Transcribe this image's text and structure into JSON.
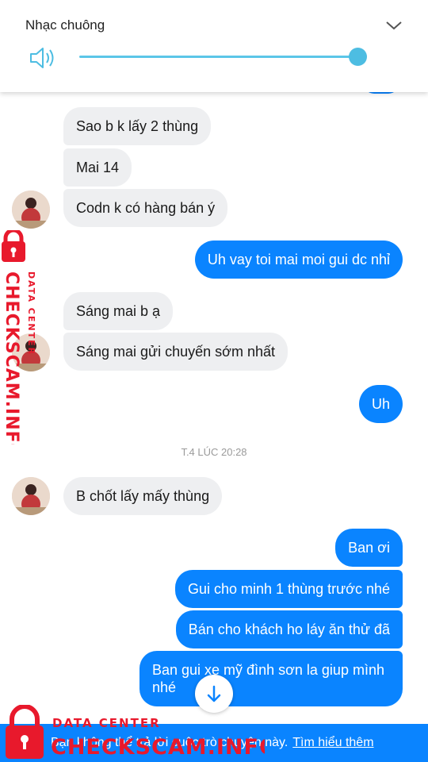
{
  "volume_panel": {
    "title": "Nhạc chuông",
    "level": 0.97
  },
  "messages": [
    {
      "side": "in",
      "text": "Sao b k lấy 2 thùng"
    },
    {
      "side": "in",
      "text": "Mai 14"
    },
    {
      "side": "in",
      "text": "Codn k có hàng bán ý"
    },
    {
      "side": "out",
      "text": "Uh vay toi mai moi gui dc nhỉ"
    },
    {
      "side": "in",
      "text": "Sáng mai b ạ"
    },
    {
      "side": "in",
      "text": "Sáng mai gửi chuyến sớm nhất"
    },
    {
      "side": "out",
      "text": "Uh"
    },
    {
      "side": "in",
      "text": "B chốt lấy mấy thùng"
    },
    {
      "side": "out",
      "text": "Ban ơi"
    },
    {
      "side": "out",
      "text": "Gui cho minh 1 thùng trước nhé"
    },
    {
      "side": "out",
      "text": "Bán cho khách ho láy ăn thử đã"
    },
    {
      "side": "out",
      "text": "Ban gui xe mỹ đình sơn la giup mình nhé"
    }
  ],
  "timestamp": "T.4 LÚC 20:28",
  "notice": {
    "text": "Bạn không thể trả lời cuộc trò chuyện này.",
    "link": "Tìm hiểu thêm"
  },
  "watermark": {
    "line1": "DATA CENTER",
    "line2": "CHECKSCAM.INFO"
  },
  "colors": {
    "outgoing": "#0a84ff",
    "incoming": "#eeeff1",
    "slider": "#4dbde2",
    "watermark": "#e8192c"
  }
}
